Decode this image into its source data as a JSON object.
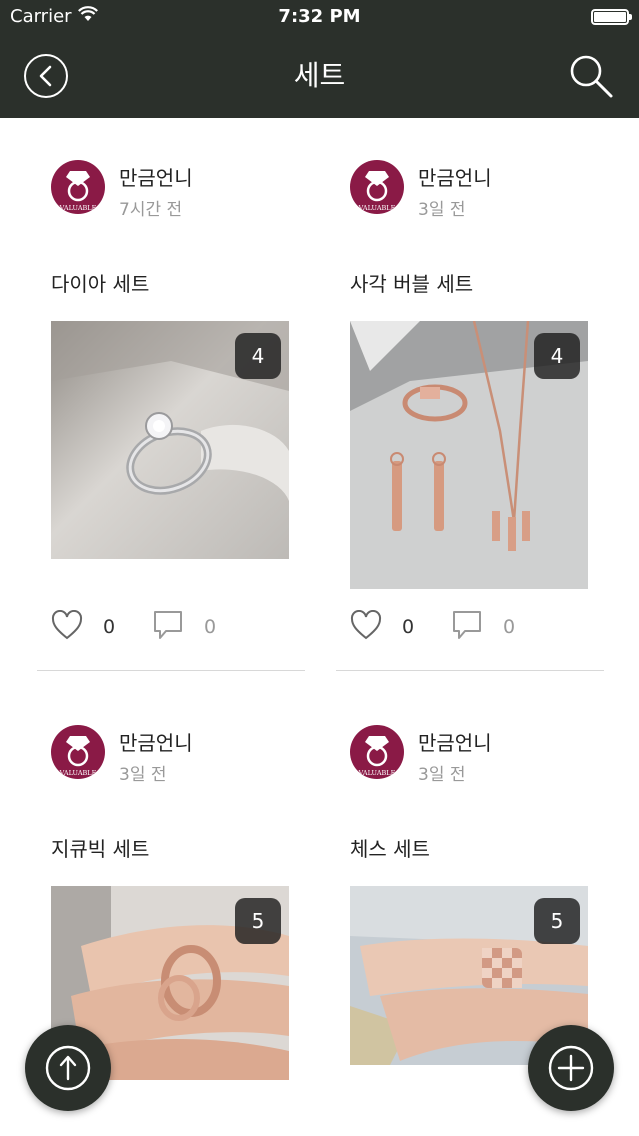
{
  "status_bar": {
    "carrier": "Carrier",
    "time": "7:32 PM",
    "battery_level": 1.0
  },
  "nav": {
    "title": "세트",
    "back_icon": "chevron-left-circle-icon",
    "search_icon": "search-icon"
  },
  "avatar_text": "VALUABLE",
  "posts": [
    {
      "author": "만금언니",
      "time_ago": "7시간 전",
      "title": "다이아 세트",
      "photo_count": "4",
      "likes": "0",
      "comments": "0",
      "photo": "diamond solitaire ring"
    },
    {
      "author": "만금언니",
      "time_ago": "3일 전",
      "title": "사각 버블 세트",
      "photo_count": "4",
      "likes": "0",
      "comments": "0",
      "photo": "rose gold square bubble necklace, earrings and ring"
    },
    {
      "author": "만금언니",
      "time_ago": "3일 전",
      "title": "지큐빅 세트",
      "photo_count": "5",
      "likes": "",
      "comments": "",
      "photo": "rose gold cubic ring on hand"
    },
    {
      "author": "만금언니",
      "time_ago": "3일 전",
      "title": "체스 세트",
      "photo_count": "5",
      "likes": "",
      "comments": "",
      "photo": "rose gold chess pattern ring on hand"
    }
  ],
  "fabs": {
    "scroll_top_icon": "arrow-up-icon",
    "add_icon": "plus-icon"
  }
}
